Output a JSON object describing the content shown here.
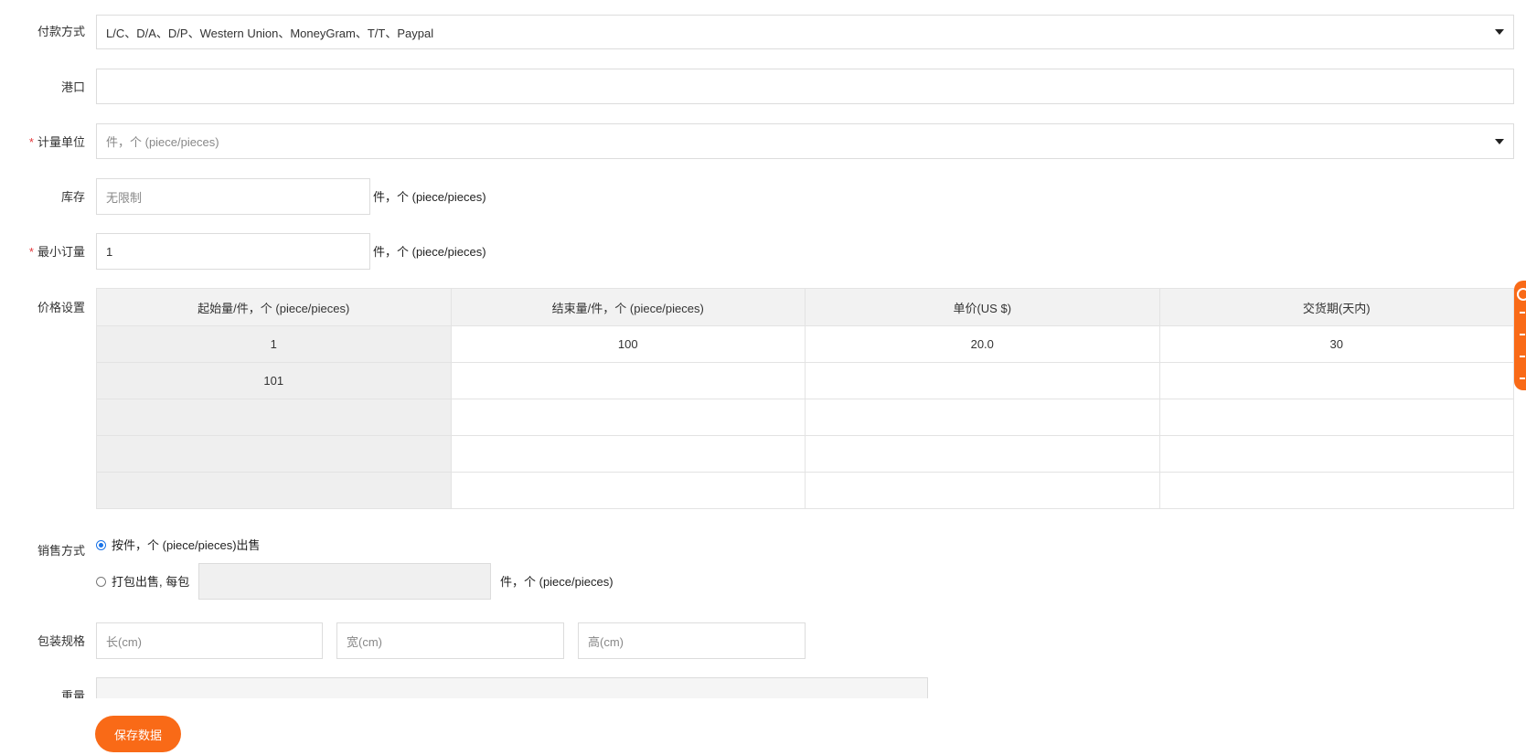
{
  "payment": {
    "label": "付款方式",
    "value": "L/C、D/A、D/P、Western Union、MoneyGram、T/T、Paypal"
  },
  "port": {
    "label": "港口",
    "value": ""
  },
  "unit_of_measure": {
    "required_mark": "*",
    "label": "计量单位",
    "value": "件，个 (piece/pieces)"
  },
  "stock": {
    "label": "库存",
    "placeholder": "无限制",
    "unit": "件，个 (piece/pieces)"
  },
  "min_order": {
    "required_mark": "*",
    "label": "最小订量",
    "value": "1",
    "unit": "件，个 (piece/pieces)"
  },
  "price_settings": {
    "label": "价格设置",
    "headers": [
      "起始量/件，个 (piece/pieces)",
      "结束量/件，个 (piece/pieces)",
      "单价(US $)",
      "交货期(天内)"
    ],
    "rows": [
      [
        "1",
        "100",
        "20.0",
        "30"
      ],
      [
        "101",
        "",
        "",
        ""
      ],
      [
        "",
        "",
        "",
        ""
      ],
      [
        "",
        "",
        "",
        ""
      ],
      [
        "",
        "",
        "",
        ""
      ]
    ]
  },
  "sales_method": {
    "label": "销售方式",
    "option_single": "按件，个 (piece/pieces)出售",
    "option_pack": "打包出售, 每包",
    "pack_unit": "件，个 (piece/pieces)",
    "selected": "option_single"
  },
  "packing": {
    "label": "包装规格",
    "length_placeholder": "长(cm)",
    "width_placeholder": "宽(cm)",
    "height_placeholder": "高(cm)"
  },
  "weight": {
    "label": "重量"
  },
  "save_button": "保存数据",
  "colors": {
    "accent": "#f96a17",
    "required": "#e4393c",
    "radio_selected": "#1a73e8"
  }
}
